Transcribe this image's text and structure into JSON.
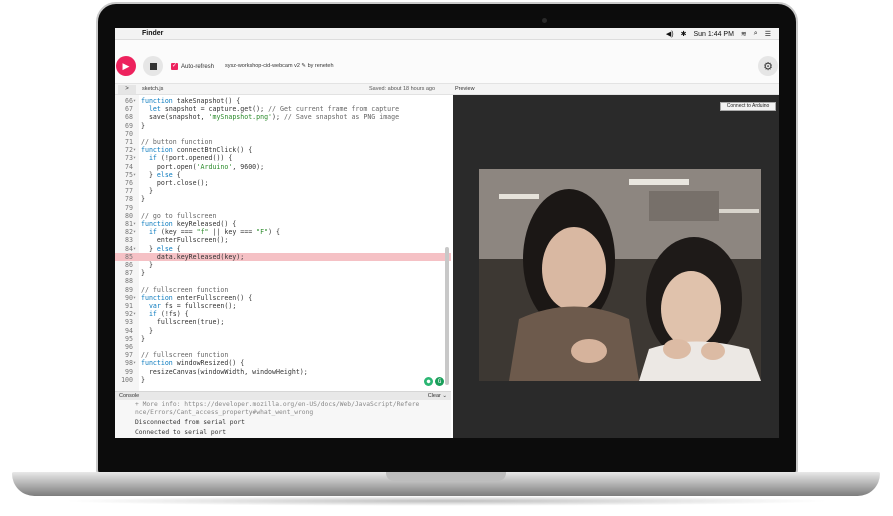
{
  "menubar": {
    "app_name": "Finder",
    "clock": "Sun 1:44 PM"
  },
  "toolbar": {
    "autorefresh_label": "Auto-refresh",
    "project_name": "sysz-workshop-cid-webcam v2",
    "author": "by reneteh"
  },
  "tabs": {
    "toggle_glyph": ">",
    "file": "sketch.js",
    "saved": "Saved: about 18 hours ago",
    "preview": "Preview"
  },
  "preview": {
    "connect_label": "Connect to Arduino"
  },
  "console": {
    "header": "Console",
    "clear": "Clear ⌄",
    "lines": [
      "+ More info: https://developer.mozilla.org/en-US/docs/Web/JavaScript/Refere",
      "nce/Errors/Cant_access_property#what_went_wrong",
      "Disconnected from serial port",
      "Connected to serial port"
    ]
  },
  "code": {
    "lines": [
      {
        "n": "66",
        "fold": true,
        "text": "function takeSnapshot() {"
      },
      {
        "n": "67",
        "fold": false,
        "text": "  let snapshot = capture.get(); // Get current frame from capture"
      },
      {
        "n": "68",
        "fold": false,
        "text": "  save(snapshot, 'mySnapshot.png'); // Save snapshot as PNG image"
      },
      {
        "n": "69",
        "fold": false,
        "text": "}"
      },
      {
        "n": "70",
        "fold": false,
        "text": ""
      },
      {
        "n": "71",
        "fold": false,
        "text": "// button function"
      },
      {
        "n": "72",
        "fold": true,
        "text": "function connectBtnClick() {"
      },
      {
        "n": "73",
        "fold": true,
        "text": "  if (!port.opened()) {"
      },
      {
        "n": "74",
        "fold": false,
        "text": "    port.open('Arduino', 9600);"
      },
      {
        "n": "75",
        "fold": true,
        "text": "  } else {"
      },
      {
        "n": "76",
        "fold": false,
        "text": "    port.close();"
      },
      {
        "n": "77",
        "fold": false,
        "text": "  }"
      },
      {
        "n": "78",
        "fold": false,
        "text": "}"
      },
      {
        "n": "79",
        "fold": false,
        "text": ""
      },
      {
        "n": "80",
        "fold": false,
        "text": "// go to fullscreen"
      },
      {
        "n": "81",
        "fold": true,
        "text": "function keyReleased() {"
      },
      {
        "n": "82",
        "fold": true,
        "text": "  if (key === \"f\" || key === \"F\") {"
      },
      {
        "n": "83",
        "fold": false,
        "text": "    enterFullscreen();"
      },
      {
        "n": "84",
        "fold": true,
        "text": "  } else {"
      },
      {
        "n": "85",
        "fold": false,
        "text": "    data.keyReleased(key);"
      },
      {
        "n": "86",
        "fold": false,
        "text": "  }"
      },
      {
        "n": "87",
        "fold": false,
        "text": "}"
      },
      {
        "n": "88",
        "fold": false,
        "text": ""
      },
      {
        "n": "89",
        "fold": false,
        "text": "// fullscreen function"
      },
      {
        "n": "90",
        "fold": true,
        "text": "function enterFullscreen() {"
      },
      {
        "n": "91",
        "fold": false,
        "text": "  var fs = fullscreen();"
      },
      {
        "n": "92",
        "fold": true,
        "text": "  if (!fs) {"
      },
      {
        "n": "93",
        "fold": false,
        "text": "    fullscreen(true);"
      },
      {
        "n": "94",
        "fold": false,
        "text": "  }"
      },
      {
        "n": "95",
        "fold": false,
        "text": "}"
      },
      {
        "n": "96",
        "fold": false,
        "text": ""
      },
      {
        "n": "97",
        "fold": false,
        "text": "// fullscreen function"
      },
      {
        "n": "98",
        "fold": true,
        "text": "function windowResized() {"
      },
      {
        "n": "99",
        "fold": false,
        "text": "  resizeCanvas(windowWidth, windowHeight);"
      },
      {
        "n": "100",
        "fold": false,
        "text": "}"
      }
    ],
    "highlighted_line": "85"
  },
  "colors": {
    "accent": "#ed225d",
    "highlight": "#f5c1c5",
    "keyword": "#0b7bbf",
    "string": "#2a8a2a"
  }
}
